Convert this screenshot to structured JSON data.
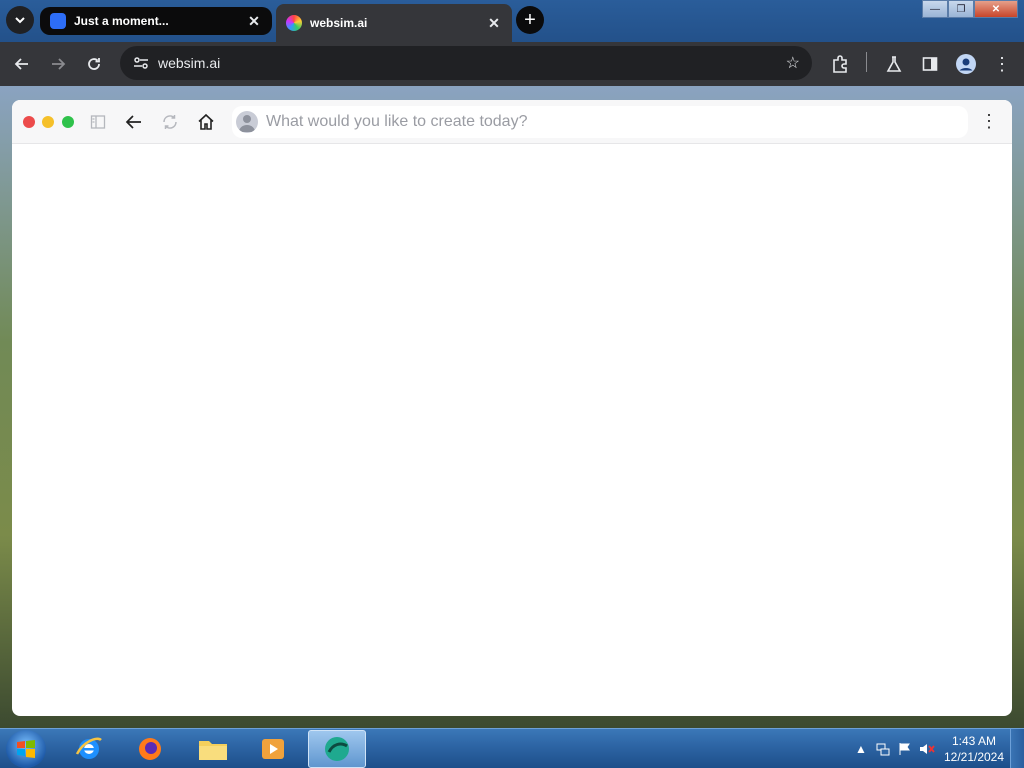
{
  "browser": {
    "tabs": [
      {
        "title": "Just a moment...",
        "active": false,
        "favicon": "cloud-favicon"
      },
      {
        "title": "websim.ai",
        "active": true,
        "favicon": "websim-favicon"
      }
    ],
    "close_glyph": "✕",
    "newtab_glyph": "+",
    "address": "websim.ai",
    "window_controls": {
      "minimize": "—",
      "maximize": "❐",
      "close": "✕"
    }
  },
  "websim": {
    "prompt_placeholder": "What would you like to create today?",
    "menu_glyph": "⋮",
    "traffic_lights": {
      "red": "#ec4b4b",
      "yellow": "#f5c02a",
      "green": "#2fc24b"
    }
  },
  "taskbar": {
    "time": "1:43 AM",
    "date": "12/21/2024",
    "apps": [
      "internet-explorer",
      "firefox",
      "file-explorer",
      "media-player",
      "websim-app"
    ]
  },
  "colors": {
    "chrome_toolbar": "#35363a",
    "chrome_tab_inactive": "#0b0b0c",
    "taskbar": "#2e66a6"
  }
}
